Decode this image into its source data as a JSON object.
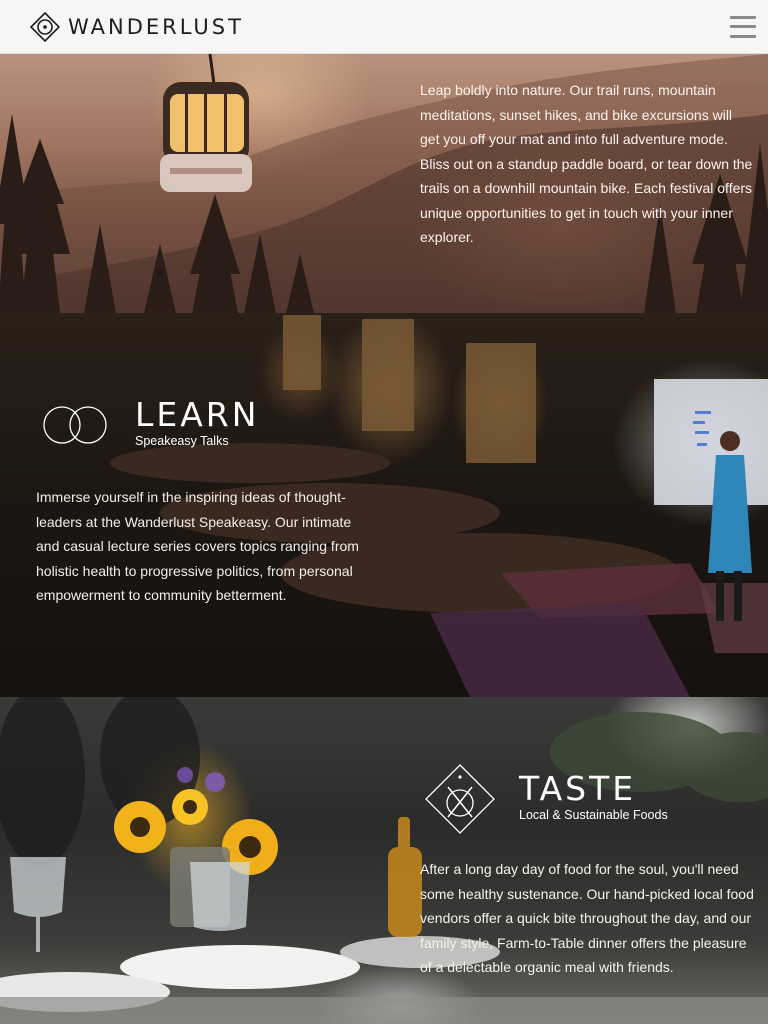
{
  "header": {
    "brand_name": "WANDERLUST",
    "logo_icon": "compass-diamond-icon",
    "menu_icon": "hamburger-menu-icon"
  },
  "explore": {
    "body": "Leap boldly into nature. Our trail runs, mountain meditations, sunset hikes, and bike excursions will get you off your mat and into full adventure mode. Bliss out on a standup paddle board, or tear down the trails on a downhill mountain bike. Each festival offers unique opportunities to get in touch with your inner explorer."
  },
  "learn": {
    "title": "LEARN",
    "subtitle": "Speakeasy Talks",
    "icon": "overlapping-circles-icon",
    "body": "Immerse yourself in the inspiring ideas of thought-leaders at the Wanderlust Speakeasy. Our intimate and casual lecture series covers topics ranging from holistic health to progressive politics, from personal empowerment to community betterment."
  },
  "taste": {
    "title": "TASTE",
    "subtitle": "Local & Sustainable Foods",
    "icon": "fork-knife-diamond-icon",
    "body": "After a long day day of food for the soul, you'll need some healthy sustenance. Our hand-picked local food vendors offer a quick bite throughout the day, and our family style, Farm-to-Table dinner offers the pleasure of a delectable organic meal with friends."
  }
}
